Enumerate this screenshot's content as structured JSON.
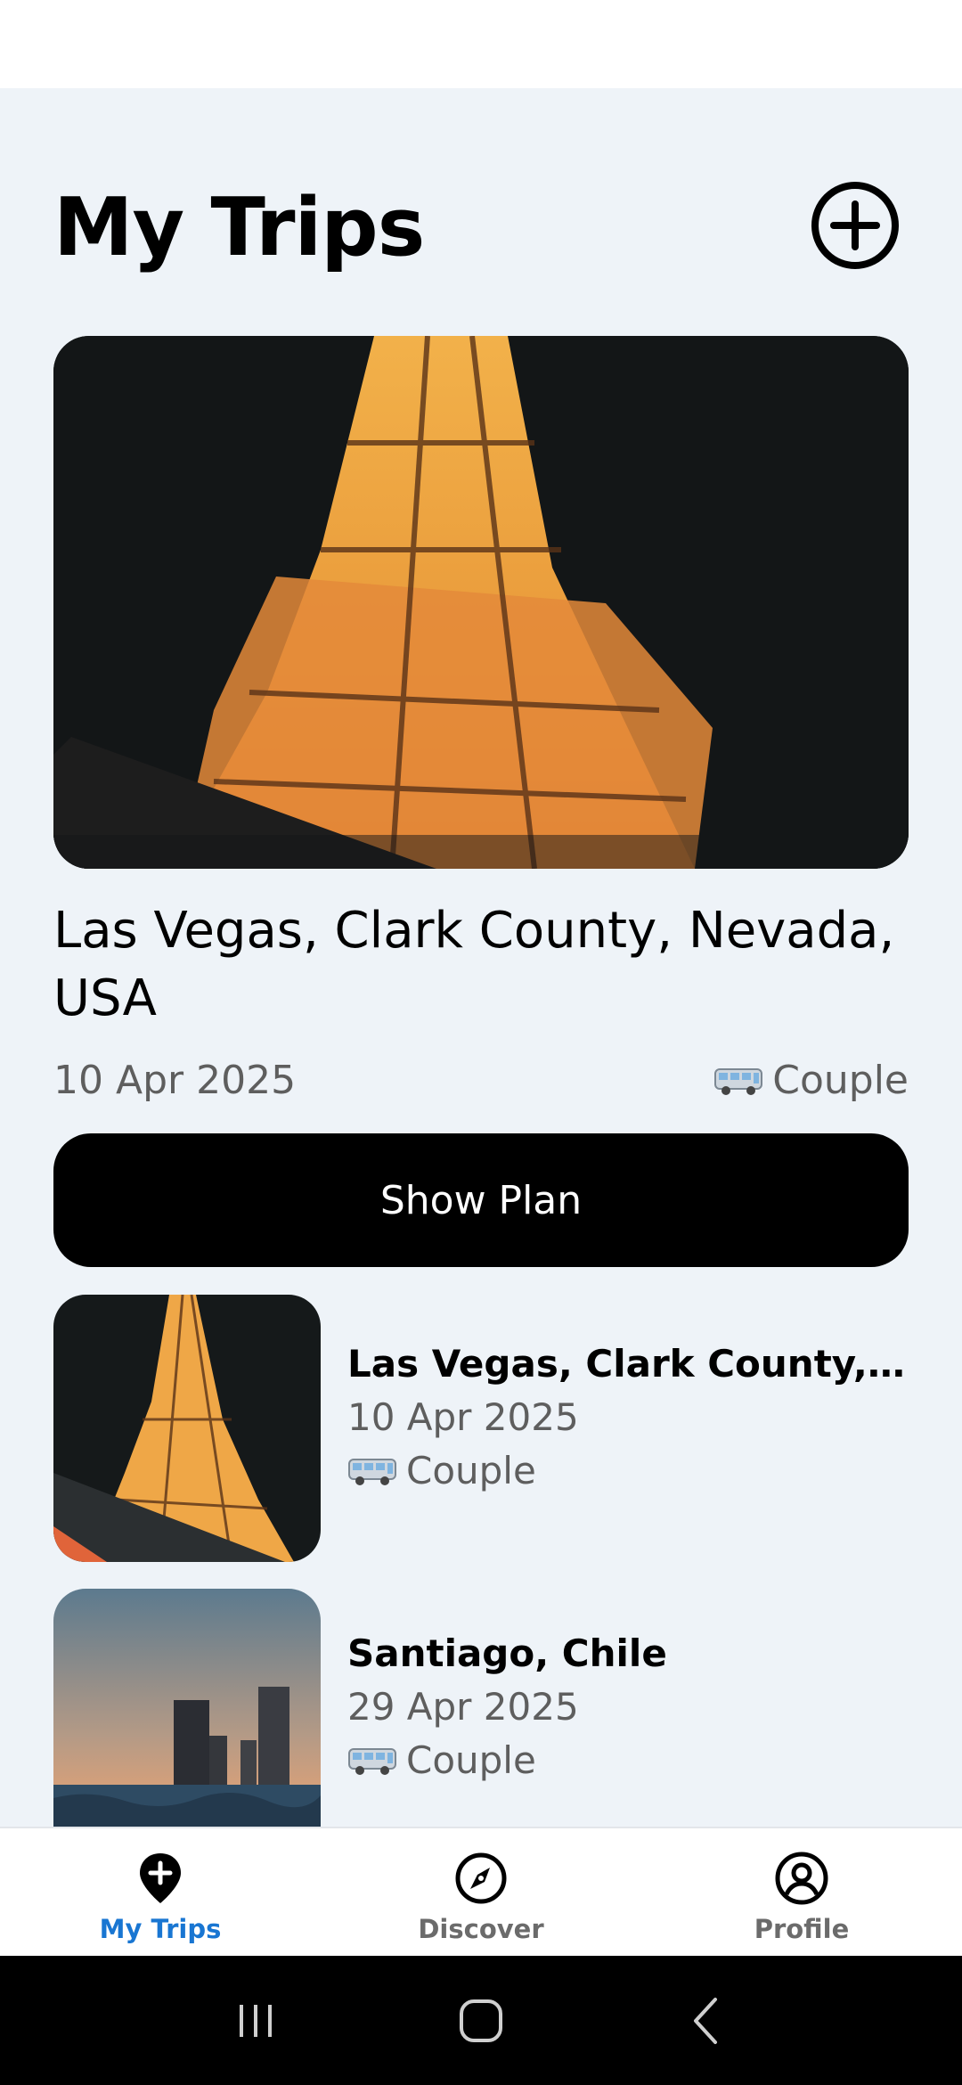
{
  "header": {
    "title": "My Trips",
    "add_icon": "plus-circle-icon"
  },
  "featured_trip": {
    "title": "Las Vegas, Clark County, Nevada, USA",
    "date": "10 Apr 2025",
    "traveler_icon": "bus-icon",
    "traveler": "Couple",
    "button_label": "Show Plan"
  },
  "trips": [
    {
      "name": "Las Vegas, Clark County, N...",
      "date": "10 Apr 2025",
      "traveler_icon": "bus-icon",
      "traveler": "Couple"
    },
    {
      "name": "Santiago, Chile",
      "date": "29 Apr 2025",
      "traveler_icon": "bus-icon",
      "traveler": "Couple"
    }
  ],
  "bottom_nav": {
    "items": [
      {
        "label": "My Trips",
        "icon": "map-pin-plus-icon",
        "active": true
      },
      {
        "label": "Discover",
        "icon": "compass-icon",
        "active": false
      },
      {
        "label": "Profile",
        "icon": "user-circle-icon",
        "active": false
      }
    ]
  },
  "colors": {
    "background": "#eef3f8",
    "accent": "#1976d2",
    "button": "#000000",
    "secondary_text": "#5e5e5e"
  }
}
